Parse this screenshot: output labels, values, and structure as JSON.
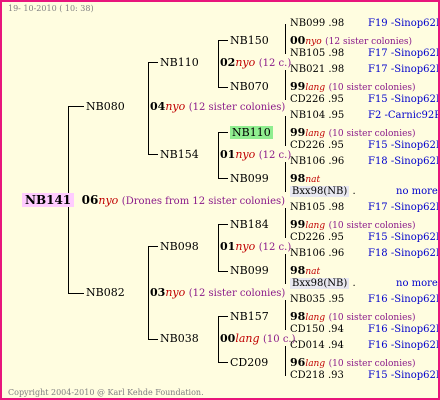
{
  "stamp_date": "19- 10-2010 ( 10: 38)",
  "copyright": "Copyright 2004-2010 @ Karl Kehde Foundation.",
  "root": {
    "id": "NB141",
    "year": "06",
    "mark": "nyo",
    "note": "(Drones from 12 sister colonies)"
  },
  "gen1": [
    {
      "id": "NB080",
      "year": "04",
      "mark": "nyo",
      "note": "(12 sister colonies)"
    },
    {
      "id": "NB082",
      "year": "03",
      "mark": "nyo",
      "note": "(12 sister colonies)"
    }
  ],
  "gen2": [
    {
      "id": "NB110",
      "year": "02",
      "mark": "nyo",
      "note": "(12 c.)"
    },
    {
      "id": "NB154",
      "year": "01",
      "mark": "nyo",
      "note": "(12 c.)"
    },
    {
      "id": "NB098",
      "year": "01",
      "mark": "nyo",
      "note": "(12 c.)"
    },
    {
      "id": "NB038",
      "year": "00",
      "mark": "lang",
      "note": "(10 c.)"
    }
  ],
  "gen3": [
    {
      "id": "NB150",
      "year": "00",
      "mark": "nyo",
      "note": "(12 sister colonies)"
    },
    {
      "id": "NB070",
      "year": "99",
      "mark": "lang",
      "note": "(10 sister colonies)"
    },
    {
      "id": "NB110",
      "year": "99",
      "mark": "lang",
      "note": "(10 sister colonies)"
    },
    {
      "id": "NB099",
      "year": "98",
      "mark": "nat",
      "note": ""
    },
    {
      "id": "NB184",
      "year": "99",
      "mark": "lang",
      "note": "(10 sister colonies)"
    },
    {
      "id": "NB099",
      "year": "98",
      "mark": "nat",
      "note": ""
    },
    {
      "id": "NB157",
      "year": "98",
      "mark": "lang",
      "note": "(10 sister colonies)"
    },
    {
      "id": "CD209",
      "year": "96",
      "mark": "lang",
      "note": "(10 sister colonies)"
    }
  ],
  "gen4": [
    {
      "id": "NB099",
      "val": ".98",
      "ref": "F19 -Sinop62R"
    },
    {
      "id": "NB105",
      "val": ".98",
      "ref": "F17 -Sinop62R"
    },
    {
      "id": "NB021",
      "val": ".98",
      "ref": "F17 -Sinop62R"
    },
    {
      "id": "CD226",
      "val": ".95",
      "ref": "F15 -Sinop62R"
    },
    {
      "id": "NB104",
      "val": ".95",
      "ref": "F2 -Carnic92R"
    },
    {
      "id": "CD226",
      "val": ".95",
      "ref": "F15 -Sinop62R"
    },
    {
      "id": "NB106",
      "val": ".96",
      "ref": "F18 -Sinop62R"
    },
    {
      "id": "Bxx98(NB)",
      "val": ".",
      "ref": "no more"
    },
    {
      "id": "NB105",
      "val": ".98",
      "ref": "F17 -Sinop62R"
    },
    {
      "id": "CD226",
      "val": ".95",
      "ref": "F15 -Sinop62R"
    },
    {
      "id": "NB106",
      "val": ".96",
      "ref": "F18 -Sinop62R"
    },
    {
      "id": "Bxx98(NB)",
      "val": ".",
      "ref": "no more"
    },
    {
      "id": "NB035",
      "val": ".95",
      "ref": "F16 -Sinop62R"
    },
    {
      "id": "CD150",
      "val": ".94",
      "ref": "F16 -Sinop62R"
    },
    {
      "id": "CD014",
      "val": ".94",
      "ref": "F16 -Sinop62R"
    },
    {
      "id": "CD218",
      "val": ".93",
      "ref": "F15 -Sinop62R"
    }
  ]
}
